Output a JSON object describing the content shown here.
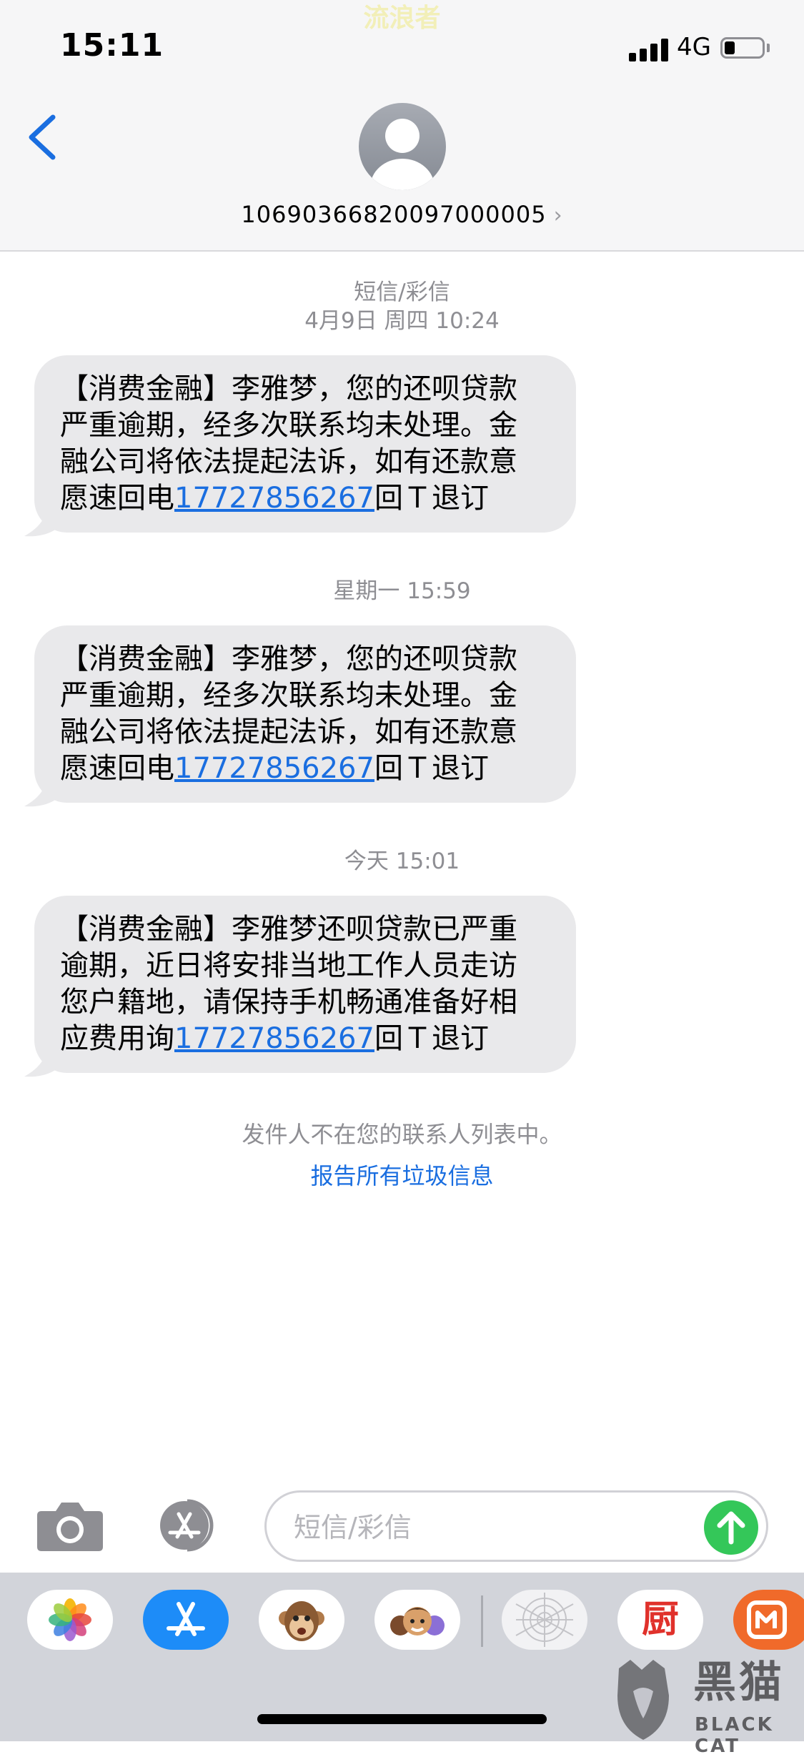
{
  "watermark_top": "流浪者",
  "status_bar": {
    "time": "15:11",
    "network": "4G",
    "battery_level": 0.2
  },
  "header": {
    "contact_number": "10690366820097000005",
    "chevron": "›"
  },
  "conversation": {
    "service_label": "短信/彩信",
    "first_timestamp": "4月9日 周四 10:24",
    "messages": [
      {
        "timestamp": "",
        "lines": [
          "【消费金融】李雅梦，您的还呗贷款",
          "严重逾期，经多次联系均未处理。金",
          "融公司将依法提起法诉，如有还款意"
        ],
        "last_prefix": "愿速回电",
        "link": "17727856267",
        "last_suffix": "回Ｔ退订"
      },
      {
        "timestamp": "星期一 15:59",
        "lines": [
          "【消费金融】李雅梦，您的还呗贷款",
          "严重逾期，经多次联系均未处理。金",
          "融公司将依法提起法诉，如有还款意"
        ],
        "last_prefix": "愿速回电",
        "link": "17727856267",
        "last_suffix": "回Ｔ退订"
      },
      {
        "timestamp": "今天 15:01",
        "lines": [
          "【消费金融】李雅梦还呗贷款已严重",
          "逾期，近日将安排当地工作人员走访",
          "您户籍地，请保持手机畅通准备好相"
        ],
        "last_prefix": "应费用询",
        "link": "17727856267",
        "last_suffix": "回Ｔ退订"
      }
    ],
    "not_in_contacts": "发件人不在您的联系人列表中。",
    "report_junk": "报告所有垃圾信息"
  },
  "input_bar": {
    "placeholder": "短信/彩信"
  },
  "app_strip": {
    "apps": [
      "photos-icon",
      "app-store-icon",
      "animoji-icon",
      "memoji-icon",
      "digital-touch-icon",
      "kitchen-app-icon",
      "mango-tv-icon"
    ],
    "kitchen_glyph": "厨"
  },
  "watermark_bottom": {
    "brand_cn": "黑猫",
    "brand_en": "BLACK CAT"
  },
  "colors": {
    "link": "#1a6ee0",
    "bubble": "#e9e9eb",
    "send": "#34c759",
    "header": "#f6f6f7"
  }
}
